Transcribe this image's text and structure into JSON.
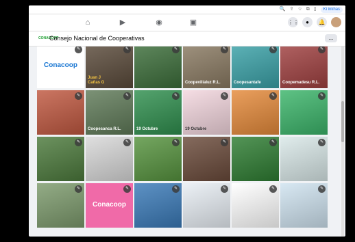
{
  "browser": {
    "profile_label": "Ki inkhas"
  },
  "page": {
    "title": "Consejo Nacional de Cooperativas",
    "logo_text": "CONACOOP",
    "more_label": "..."
  },
  "tiles": [
    {
      "bg": "#ffffff",
      "kind": "logo",
      "text": "Conacoop",
      "color": "#1976d2"
    },
    {
      "bg": "#5a4a3a",
      "kind": "photo",
      "caption": "Juan J\nCañas G",
      "cap_color": "#f5c542"
    },
    {
      "bg": "#3c6e3a",
      "kind": "photo"
    },
    {
      "bg": "#8a7a62",
      "kind": "photo",
      "caption": "Coopevillaluz R.L.",
      "cap_color": "#ffffff"
    },
    {
      "bg": "#3aa2a8",
      "kind": "photo",
      "caption": "Coopesantafe",
      "cap_color": "#ffffff"
    },
    {
      "bg": "#a04040",
      "kind": "photo",
      "caption": "Coopemadesu R.L.",
      "cap_color": "#ffffff"
    },
    {
      "bg": "#c05840",
      "kind": "photo"
    },
    {
      "bg": "#5f7a58",
      "kind": "photo",
      "caption": "Coopesanca R.L.",
      "cap_color": "#ffffff"
    },
    {
      "bg": "#2f8f4e",
      "kind": "photo",
      "caption": "19 Octubre",
      "cap_color": "#ffffff"
    },
    {
      "bg": "#f3d6de",
      "kind": "photo",
      "caption": "19 Octubre",
      "cap_color": "#333333"
    },
    {
      "bg": "#e58a3a",
      "kind": "photo"
    },
    {
      "bg": "#3bb56a",
      "kind": "photo"
    },
    {
      "bg": "#4c7a3c",
      "kind": "photo"
    },
    {
      "bg": "#d8d8d8",
      "kind": "photo"
    },
    {
      "bg": "#56933e",
      "kind": "photo"
    },
    {
      "bg": "#6a4a3a",
      "kind": "photo"
    },
    {
      "bg": "#2e7d32",
      "kind": "photo"
    },
    {
      "bg": "#d9e8e8",
      "kind": "photo"
    },
    {
      "bg": "#7c9a6c",
      "kind": "photo"
    },
    {
      "bg": "#f06aa8",
      "kind": "logo",
      "text": "Conacoop",
      "color": "#ffffff"
    },
    {
      "bg": "#3a7ab8",
      "kind": "photo"
    },
    {
      "bg": "#e8eef4",
      "kind": "photo"
    },
    {
      "bg": "#ffffff",
      "kind": "photo"
    },
    {
      "bg": "#cfe3f0",
      "kind": "photo"
    }
  ]
}
